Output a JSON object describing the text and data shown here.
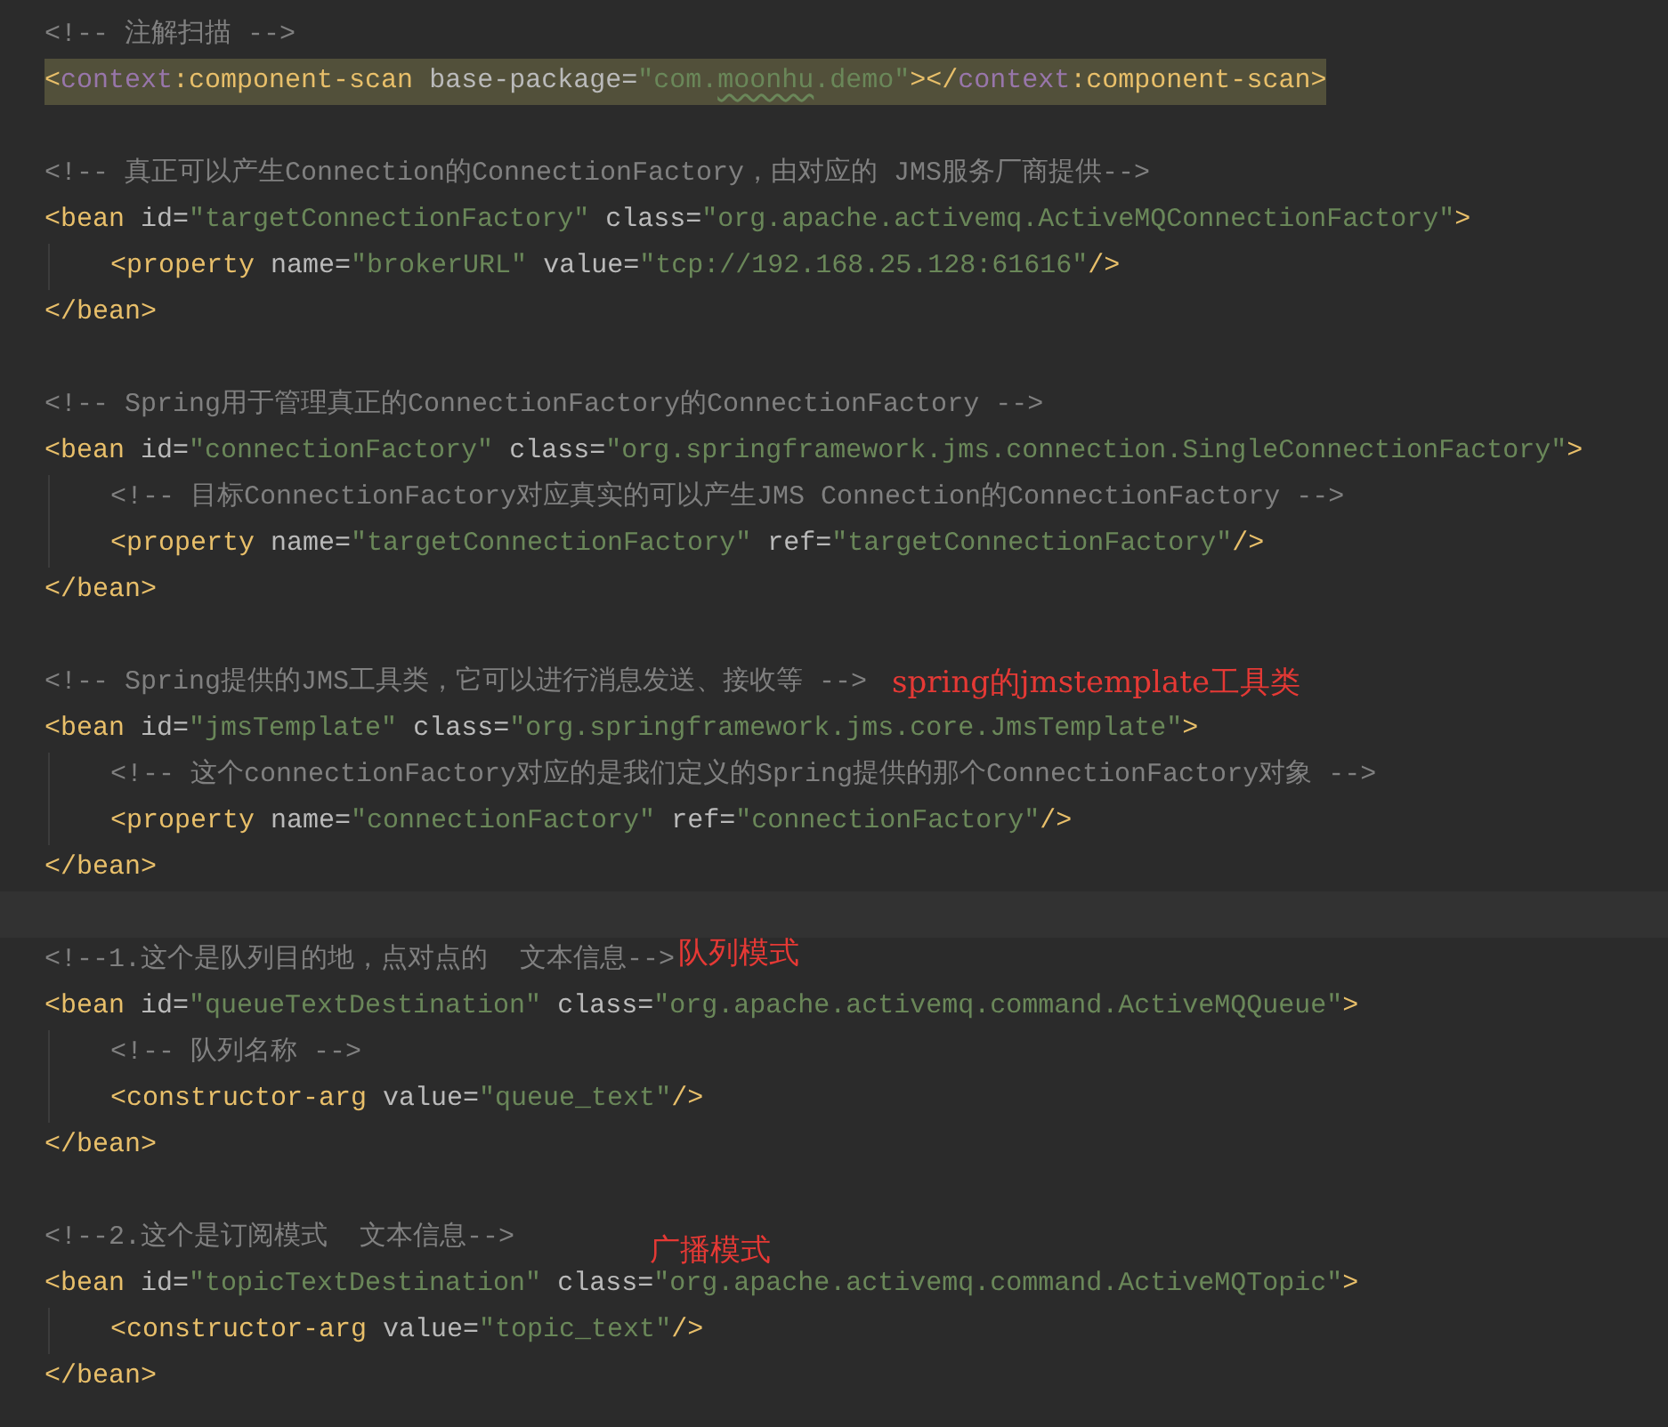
{
  "editor": {
    "lines": [
      {
        "kind": "code",
        "matched": false,
        "tokens": [
          {
            "kind": "c",
            "text": "<!-- 注解扫描 -->"
          }
        ]
      },
      {
        "kind": "code",
        "matched": true,
        "tokens": [
          {
            "kind": "b",
            "text": "<"
          },
          {
            "kind": "n",
            "text": "context"
          },
          {
            "kind": "t",
            "text": ":component-scan "
          },
          {
            "kind": "a",
            "text": "base-package="
          },
          {
            "kind": "v",
            "text": "\"com."
          },
          {
            "kind": "v",
            "text": "moonhu",
            "typo": true
          },
          {
            "kind": "v",
            "text": ".demo\""
          },
          {
            "kind": "b",
            "text": "></"
          },
          {
            "kind": "n",
            "text": "context"
          },
          {
            "kind": "t",
            "text": ":component-scan"
          },
          {
            "kind": "b",
            "text": ">"
          }
        ]
      },
      {
        "kind": "blank",
        "current": false
      },
      {
        "kind": "code",
        "matched": false,
        "tokens": [
          {
            "kind": "c",
            "text": "<!-- 真正可以产生Connection的ConnectionFactory，由对应的 JMS服务厂商提供-->"
          }
        ]
      },
      {
        "kind": "code",
        "matched": false,
        "tokens": [
          {
            "kind": "t",
            "text": "<bean "
          },
          {
            "kind": "a",
            "text": "id="
          },
          {
            "kind": "v",
            "text": "\"targetConnectionFactory\" "
          },
          {
            "kind": "a",
            "text": "class="
          },
          {
            "kind": "v",
            "text": "\"org.apache.activemq.ActiveMQConnectionFactory\""
          },
          {
            "kind": "b",
            "text": ">"
          }
        ],
        "children": [
          {
            "kind": "code",
            "matched": false,
            "tokens": [
              {
                "kind": "t",
                "text": "<property "
              },
              {
                "kind": "a",
                "text": "name="
              },
              {
                "kind": "v",
                "text": "\"brokerURL\" "
              },
              {
                "kind": "a",
                "text": "value="
              },
              {
                "kind": "v",
                "text": "\"tcp://192.168.25.128:61616\""
              },
              {
                "kind": "b",
                "text": "/>"
              }
            ]
          }
        ]
      },
      {
        "kind": "code",
        "matched": false,
        "tokens": [
          {
            "kind": "t",
            "text": "</bean>"
          }
        ]
      },
      {
        "kind": "blank",
        "current": false
      },
      {
        "kind": "code",
        "matched": false,
        "tokens": [
          {
            "kind": "c",
            "text": "<!-- Spring用于管理真正的ConnectionFactory的ConnectionFactory -->"
          }
        ]
      },
      {
        "kind": "code",
        "matched": false,
        "tokens": [
          {
            "kind": "t",
            "text": "<bean "
          },
          {
            "kind": "a",
            "text": "id="
          },
          {
            "kind": "v",
            "text": "\"connectionFactory\" "
          },
          {
            "kind": "a",
            "text": "class="
          },
          {
            "kind": "v",
            "text": "\"org.springframework.jms.connection.SingleConnectionFactory\""
          },
          {
            "kind": "b",
            "text": ">"
          }
        ],
        "children": [
          {
            "kind": "code",
            "matched": false,
            "tokens": [
              {
                "kind": "c",
                "text": "<!-- 目标ConnectionFactory对应真实的可以产生JMS Connection的ConnectionFactory -->"
              }
            ]
          },
          {
            "kind": "code",
            "matched": false,
            "tokens": [
              {
                "kind": "t",
                "text": "<property "
              },
              {
                "kind": "a",
                "text": "name="
              },
              {
                "kind": "v",
                "text": "\"targetConnectionFactory\" "
              },
              {
                "kind": "a",
                "text": "ref="
              },
              {
                "kind": "v",
                "text": "\"targetConnectionFactory\""
              },
              {
                "kind": "b",
                "text": "/>"
              }
            ]
          }
        ]
      },
      {
        "kind": "code",
        "matched": false,
        "tokens": [
          {
            "kind": "t",
            "text": "</bean>"
          }
        ]
      },
      {
        "kind": "blank",
        "current": false
      },
      {
        "kind": "code",
        "matched": false,
        "tokens": [
          {
            "kind": "c",
            "text": "<!-- Spring提供的JMS工具类，它可以进行消息发送、接收等 -->"
          }
        ],
        "note": {
          "kind": "inline",
          "text": "spring的jmstemplate工具类"
        }
      },
      {
        "kind": "code",
        "matched": false,
        "tokens": [
          {
            "kind": "t",
            "text": "<bean "
          },
          {
            "kind": "a",
            "text": "id="
          },
          {
            "kind": "v",
            "text": "\"jmsTemplate\" "
          },
          {
            "kind": "a",
            "text": "class="
          },
          {
            "kind": "v",
            "text": "\"org.springframework.jms.core.JmsTemplate\""
          },
          {
            "kind": "b",
            "text": ">"
          }
        ],
        "children": [
          {
            "kind": "code",
            "matched": false,
            "tokens": [
              {
                "kind": "c",
                "text": "<!-- 这个connectionFactory对应的是我们定义的Spring提供的那个ConnectionFactory对象 -->"
              }
            ]
          },
          {
            "kind": "code",
            "matched": false,
            "tokens": [
              {
                "kind": "t",
                "text": "<property "
              },
              {
                "kind": "a",
                "text": "name="
              },
              {
                "kind": "v",
                "text": "\"connectionFactory\" "
              },
              {
                "kind": "a",
                "text": "ref="
              },
              {
                "kind": "v",
                "text": "\"connectionFactory\""
              },
              {
                "kind": "b",
                "text": "/>"
              }
            ]
          }
        ]
      },
      {
        "kind": "code",
        "matched": false,
        "tokens": [
          {
            "kind": "t",
            "text": "</bean>"
          }
        ]
      },
      {
        "kind": "blank",
        "current": true
      },
      {
        "kind": "code",
        "matched": false,
        "tokens": [
          {
            "kind": "c",
            "text": "<!--1.这个是队列目的地，点对点的  文本信息-->"
          }
        ],
        "note": {
          "kind": "tight",
          "text": "队列模式"
        }
      },
      {
        "kind": "code",
        "matched": false,
        "tokens": [
          {
            "kind": "t",
            "text": "<bean "
          },
          {
            "kind": "a",
            "text": "id="
          },
          {
            "kind": "v",
            "text": "\"queueTextDestination\" "
          },
          {
            "kind": "a",
            "text": "class="
          },
          {
            "kind": "v",
            "text": "\"org.apache.activemq.command.ActiveMQQueue\""
          },
          {
            "kind": "b",
            "text": ">"
          }
        ],
        "children": [
          {
            "kind": "code",
            "matched": false,
            "tokens": [
              {
                "kind": "c",
                "text": "<!-- 队列名称 -->"
              }
            ]
          },
          {
            "kind": "code",
            "matched": false,
            "tokens": [
              {
                "kind": "t",
                "text": "<constructor-arg "
              },
              {
                "kind": "a",
                "text": "value="
              },
              {
                "kind": "v",
                "text": "\"queue_text\""
              },
              {
                "kind": "b",
                "text": "/>"
              }
            ]
          }
        ]
      },
      {
        "kind": "code",
        "matched": false,
        "tokens": [
          {
            "kind": "t",
            "text": "</bean>"
          }
        ]
      },
      {
        "kind": "blank",
        "current": false
      },
      {
        "kind": "code",
        "matched": false,
        "tokens": [
          {
            "kind": "c",
            "text": "<!--2.这个是订阅模式  文本信息-->"
          }
        ],
        "note": {
          "kind": "floating",
          "text": "广播模式"
        }
      },
      {
        "kind": "code",
        "matched": false,
        "tokens": [
          {
            "kind": "t",
            "text": "<bean "
          },
          {
            "kind": "a",
            "text": "id="
          },
          {
            "kind": "v",
            "text": "\"topicTextDestination\" "
          },
          {
            "kind": "a",
            "text": "class="
          },
          {
            "kind": "v",
            "text": "\"org.apache.activemq.command.ActiveMQTopic\""
          },
          {
            "kind": "b",
            "text": ">"
          }
        ],
        "children": [
          {
            "kind": "code",
            "matched": false,
            "tokens": [
              {
                "kind": "t",
                "text": "<constructor-arg "
              },
              {
                "kind": "a",
                "text": "value="
              },
              {
                "kind": "v",
                "text": "\"topic_text\""
              },
              {
                "kind": "b",
                "text": "/>"
              }
            ]
          }
        ]
      },
      {
        "kind": "code",
        "matched": false,
        "tokens": [
          {
            "kind": "t",
            "text": "</bean>"
          }
        ]
      }
    ]
  }
}
